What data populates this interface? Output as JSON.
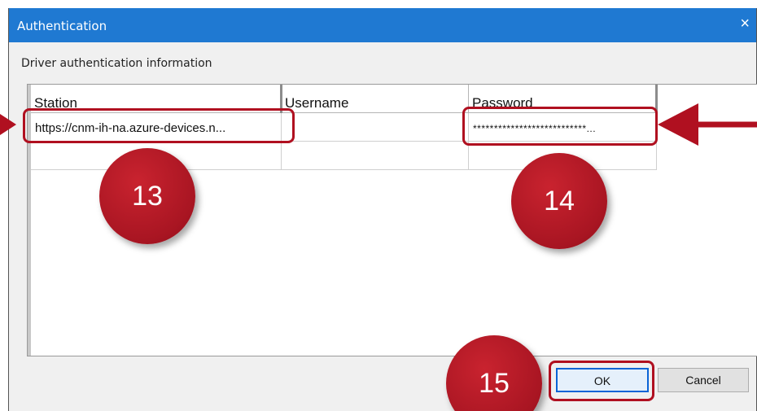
{
  "dialog": {
    "title": "Authentication",
    "close_glyph": "×",
    "caption": "Driver authentication information"
  },
  "grid": {
    "columns": [
      "Station",
      "Username",
      "Password"
    ],
    "rows": [
      {
        "station": "https://cnm-ih-na.azure-devices.n...",
        "username": "",
        "password": "***************************..."
      },
      {
        "station": "",
        "username": "",
        "password": ""
      }
    ]
  },
  "buttons": {
    "ok": "OK",
    "cancel": "Cancel"
  },
  "annotations": {
    "badge_station": "13",
    "badge_password": "14",
    "badge_ok": "15",
    "accent_color": "#b01020"
  }
}
